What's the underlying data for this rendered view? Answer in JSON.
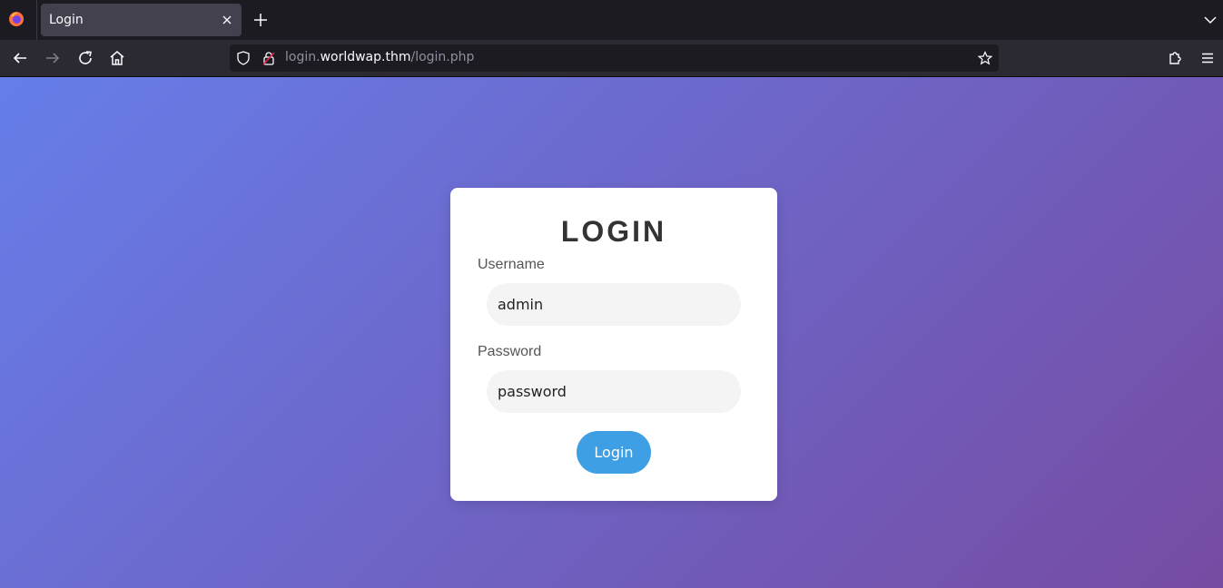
{
  "browser": {
    "tab": {
      "title": "Login"
    },
    "url": {
      "prefix": "login.",
      "domain": "worldwap.thm",
      "path": "/login.php"
    },
    "icons": {
      "logo": "firefox-logo-icon",
      "tab_close": "close-icon",
      "new_tab": "plus-icon",
      "tab_list": "chevron-down-icon",
      "back": "back-arrow-icon",
      "forward": "forward-arrow-icon",
      "reload": "reload-icon",
      "home": "home-icon",
      "tracking": "shield-icon",
      "connection": "insecure-lock-icon",
      "bookmark": "star-icon",
      "extensions": "puzzle-icon",
      "menu": "hamburger-menu-icon"
    }
  },
  "page": {
    "background_colors": [
      "#667eea",
      "#764ba2"
    ],
    "form": {
      "title": "LOGIN",
      "username_label": "Username",
      "username_value": "admin",
      "password_label": "Password",
      "password_value": "password",
      "submit_label": "Login",
      "button_color": "#3f9fe4"
    }
  }
}
